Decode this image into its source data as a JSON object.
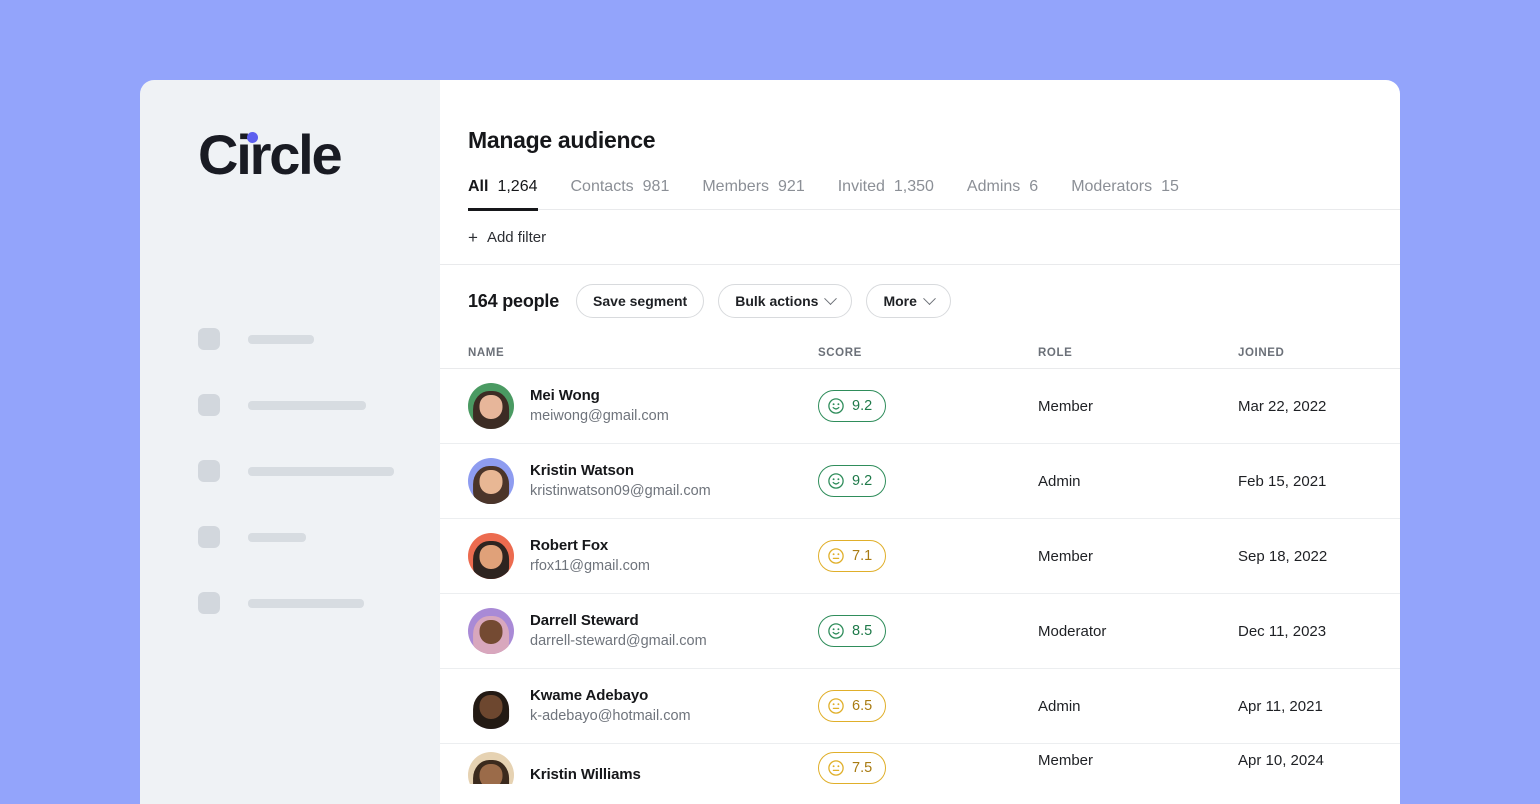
{
  "theme": {
    "page_background": "#93a4fb",
    "sidebar_background": "#eff2f5",
    "panel_background": "#ffffff",
    "accent": "#5d5fef",
    "score_good": "#2f8d5b",
    "score_mid": "#e0af2a"
  },
  "sidebar": {
    "logo_text": "Circle",
    "skeleton_bar_widths": [
      66,
      118,
      146,
      58,
      116
    ]
  },
  "header": {
    "title": "Manage audience"
  },
  "tabs": [
    {
      "label": "All",
      "count": "1,264",
      "active": true
    },
    {
      "label": "Contacts",
      "count": "981",
      "active": false
    },
    {
      "label": "Members",
      "count": "921",
      "active": false
    },
    {
      "label": "Invited",
      "count": "1,350",
      "active": false
    },
    {
      "label": "Admins",
      "count": "6",
      "active": false
    },
    {
      "label": "Moderators",
      "count": "15",
      "active": false
    }
  ],
  "filter_bar": {
    "add_filter_label": "Add filter",
    "plus_glyph": "+"
  },
  "toolbar": {
    "people_count": "164 people",
    "save_segment_label": "Save segment",
    "bulk_actions_label": "Bulk actions",
    "more_label": "More"
  },
  "table": {
    "columns": [
      "NAME",
      "SCORE",
      "ROLE",
      "JOINED"
    ],
    "rows": [
      {
        "name": "Mei Wong",
        "email": "meiwong@gmail.com",
        "score": "9.2",
        "score_tone": "good",
        "role": "Member",
        "joined": "Mar 22, 2022",
        "avatar_bg": "#4a9a62",
        "avatar_hair": "#3c2c24",
        "avatar_skin": "#e7b69a",
        "avatar_body": "#d8c2c0"
      },
      {
        "name": "Kristin Watson",
        "email": "kristinwatson09@gmail.com",
        "score": "9.2",
        "score_tone": "good",
        "role": "Admin",
        "joined": "Feb 15, 2021",
        "avatar_bg": "#8e9cf0",
        "avatar_hair": "#4b352a",
        "avatar_skin": "#e8b794",
        "avatar_body": "#3b2a22"
      },
      {
        "name": "Robert Fox",
        "email": "rfox11@gmail.com",
        "score": "7.1",
        "score_tone": "mid",
        "role": "Member",
        "joined": "Sep 18, 2022",
        "avatar_bg": "#ec6b4f",
        "avatar_hair": "#2e2420",
        "avatar_skin": "#e0a179",
        "avatar_body": "#c2392d"
      },
      {
        "name": "Darrell Steward",
        "email": "darrell-steward@gmail.com",
        "score": "8.5",
        "score_tone": "good",
        "role": "Moderator",
        "joined": "Dec 11, 2023",
        "avatar_bg": "#a98ad6",
        "avatar_hair": "#d8a7bd",
        "avatar_skin": "#744a32",
        "avatar_body": "#d489a5"
      },
      {
        "name": "Kwame Adebayo",
        "email": "k-adebayo@hotmail.com",
        "score": "6.5",
        "score_tone": "mid",
        "role": "Admin",
        "joined": "Apr 11, 2021",
        "avatar_bg": "#ecc košík",
        "avatar_hair": "#231a14",
        "avatar_skin": "#6d472f",
        "avatar_body": "#9d85c4"
      },
      {
        "name": "Kristin Williams",
        "email": "",
        "score": "7.5",
        "score_tone": "mid",
        "role": "Member",
        "joined": "Apr 10, 2024",
        "avatar_bg": "#e6d2b2",
        "avatar_hair": "#3b2a1d",
        "avatar_skin": "#9b6b49",
        "avatar_body": "#e8e0d2"
      }
    ]
  }
}
